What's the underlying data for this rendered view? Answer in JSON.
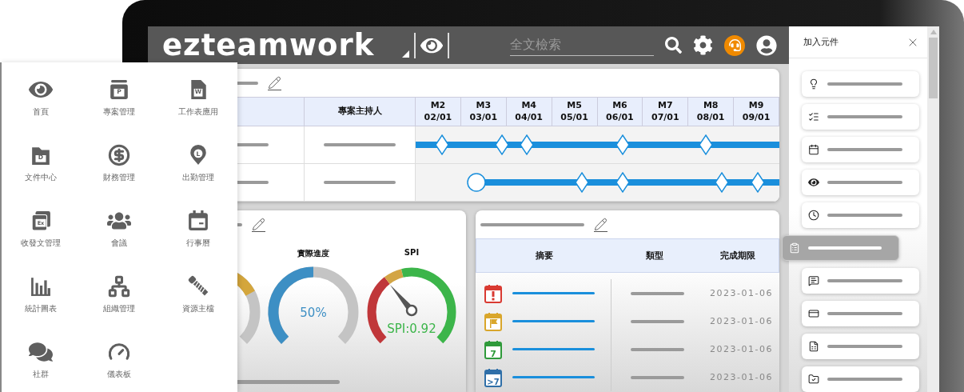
{
  "topbar": {
    "logo": "ezteamwork",
    "search": {
      "placeholder": "全文檢索"
    }
  },
  "app_menu": {
    "items": [
      {
        "kind": "eye",
        "label": "首頁"
      },
      {
        "kind": "tab-doc",
        "glyph": "P",
        "label": "專案管理"
      },
      {
        "kind": "page-doc",
        "glyph": "W",
        "label": "工作表應用"
      },
      {
        "kind": "folder-doc",
        "glyph": "D",
        "label": "文件中心"
      },
      {
        "kind": "dollar",
        "label": "財務管理"
      },
      {
        "kind": "pin",
        "glyph": "L",
        "label": "出勤管理"
      },
      {
        "kind": "stack-doc",
        "glyph": "Ex",
        "label": "收發文管理"
      },
      {
        "kind": "group",
        "label": "會議"
      },
      {
        "kind": "calendar",
        "label": "行事曆"
      },
      {
        "kind": "bars",
        "label": "統計圖表"
      },
      {
        "kind": "org",
        "label": "組織管理"
      },
      {
        "kind": "screw",
        "label": "資源主檔"
      },
      {
        "kind": "chat",
        "label": "社群"
      },
      {
        "kind": "gauge",
        "label": "儀表板"
      }
    ]
  },
  "gantt_panel": {
    "columns": [
      "專案主持人"
    ],
    "months": [
      {
        "label": "M2",
        "date": "02/01"
      },
      {
        "label": "M3",
        "date": "03/01"
      },
      {
        "label": "M4",
        "date": "04/01"
      },
      {
        "label": "M5",
        "date": "05/01"
      },
      {
        "label": "M6",
        "date": "06/01"
      },
      {
        "label": "M7",
        "date": "07/01"
      },
      {
        "label": "M8",
        "date": "08/01"
      },
      {
        "label": "M9",
        "date": "09/01"
      }
    ],
    "rows": [
      {
        "kind": "running"
      },
      {
        "kind": "starting"
      }
    ]
  },
  "progress_panel": {
    "gauges": [
      {
        "kind": "partial",
        "color": "#d4a63c"
      },
      {
        "kind": "progress",
        "label": "實際進度",
        "color": "#3d8fc4",
        "level": 0.5,
        "reading": "50%"
      },
      {
        "kind": "spi",
        "label": "SPI",
        "reading": "SPI:0.92"
      }
    ]
  },
  "task_panel": {
    "columns": [
      "摘要",
      "類型",
      "完成期限"
    ],
    "rows": [
      {
        "kind": "alert",
        "color": "#d93a32",
        "due": "2023-01-06"
      },
      {
        "kind": "flag",
        "color": "#d9a62b",
        "due": "2023-01-06"
      },
      {
        "kind": "day",
        "color": "#2f9a3a",
        "mark": "7",
        "due": "2023-01-06"
      },
      {
        "kind": "day",
        "color": "#2f6fa8",
        "mark": ">7",
        "due": "2023-01-06"
      }
    ]
  },
  "add_panel": {
    "title": "加入元件",
    "items": [
      {
        "kind": "bulb",
        "dragging": false
      },
      {
        "kind": "checklist",
        "dragging": false
      },
      {
        "kind": "calendar",
        "dragging": false
      },
      {
        "kind": "eye",
        "dragging": false
      },
      {
        "kind": "clock",
        "dragging": false
      },
      {
        "kind": "clipboard",
        "dragging": true
      },
      {
        "kind": "message",
        "dragging": false
      },
      {
        "kind": "card",
        "dragging": false
      },
      {
        "kind": "sheet",
        "dragging": false
      },
      {
        "kind": "folder",
        "dragging": false
      }
    ]
  }
}
